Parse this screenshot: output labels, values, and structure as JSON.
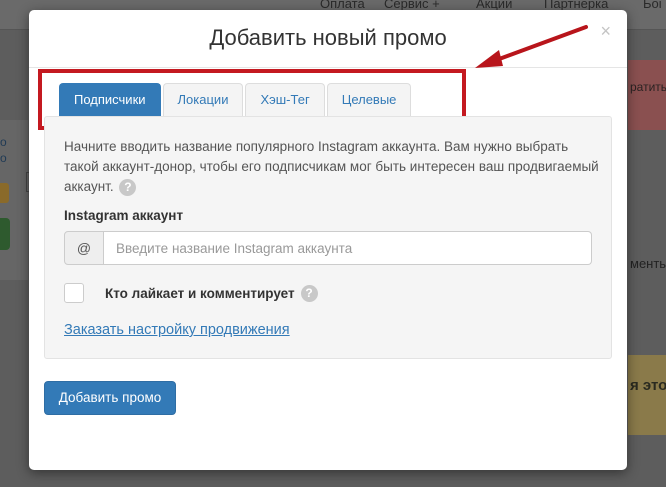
{
  "background": {
    "nav_links": [
      "Оплата",
      "Сервис +",
      "Акции",
      "Партнерка",
      "Боі"
    ],
    "right_text_1": "ратить",
    "right_text_2": "ментьі",
    "right_text_3": "я это",
    "left_link": "о",
    "left_link_2": "о"
  },
  "modal": {
    "title": "Добавить новый промо",
    "close_label": "×",
    "tabs": [
      {
        "label": "Подписчики",
        "active": true
      },
      {
        "label": "Локации",
        "active": false
      },
      {
        "label": "Хэш-Тег",
        "active": false
      },
      {
        "label": "Целевые",
        "active": false
      }
    ],
    "description": "Начните вводить название популярного Instagram аккаунта. Вам нужно выбрать такой аккаунт-донор, чтобы его подписчикам мог быть интересен ваш продвигаемый аккаунт.",
    "help_icon": "?",
    "account_label": "Instagram аккаунт",
    "input_addon": "@",
    "input_placeholder": "Введите название Instagram аккаунта",
    "input_value": "",
    "checkbox_label": "Кто лайкает и комментирует",
    "checkbox_checked": false,
    "link_text": "Заказать настройку продвижения",
    "submit_label": "Добавить промо"
  },
  "colors": {
    "accent": "#337ab7",
    "annotation_red": "#c41920"
  }
}
